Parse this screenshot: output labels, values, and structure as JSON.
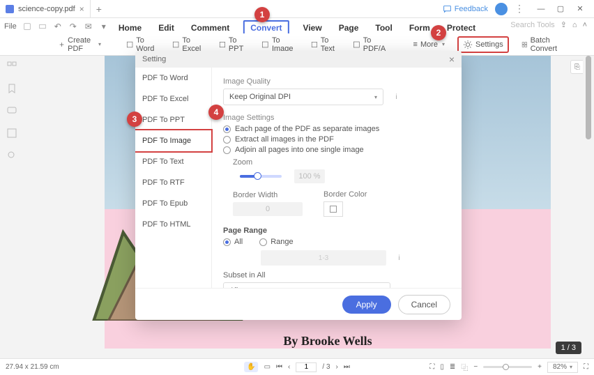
{
  "titlebar": {
    "tab_title": "science-copy.pdf",
    "feedback": "Feedback"
  },
  "file_label": "File",
  "menu": {
    "items": [
      "Home",
      "Edit",
      "Comment",
      "Convert",
      "View",
      "Page",
      "Tool",
      "Form",
      "Protect"
    ],
    "search_placeholder": "Search Tools"
  },
  "toolbar": {
    "create": "Create PDF",
    "to_word": "To Word",
    "to_excel": "To Excel",
    "to_ppt": "To PPT",
    "to_image": "To Image",
    "to_text": "To Text",
    "to_pdfa": "To PDF/A",
    "more": "More",
    "settings": "Settings",
    "batch": "Batch Convert"
  },
  "modal": {
    "title": "Setting",
    "side_items": [
      "PDF To Word",
      "PDF To Excel",
      "PDF To PPT",
      "PDF To Image",
      "PDF To Text",
      "PDF To RTF",
      "PDF To Epub",
      "PDF To HTML"
    ],
    "image_quality_label": "Image Quality",
    "image_quality_value": "Keep Original DPI",
    "image_settings_label": "Image Settings",
    "opt_each": "Each page of the PDF as separate images",
    "opt_extract": "Extract all images in the PDF",
    "opt_adjoin": "Adjoin all pages into one single image",
    "zoom_label": "Zoom",
    "zoom_value": "100 %",
    "border_width_label": "Border Width",
    "border_width_value": "0",
    "border_color_label": "Border Color",
    "page_range_label": "Page Range",
    "opt_all": "All",
    "opt_range": "Range",
    "range_value": "1-3",
    "subset_label": "Subset in All",
    "subset_value": "All pages",
    "apply": "Apply",
    "cancel": "Cancel"
  },
  "document": {
    "byline": "By Brooke Wells",
    "page_indicator": "1 / 3"
  },
  "statusbar": {
    "dims": "27.94 x 21.59 cm",
    "page": "1",
    "pages_total": "/ 3",
    "zoom": "82%"
  },
  "badges": [
    "1",
    "2",
    "3",
    "4"
  ]
}
